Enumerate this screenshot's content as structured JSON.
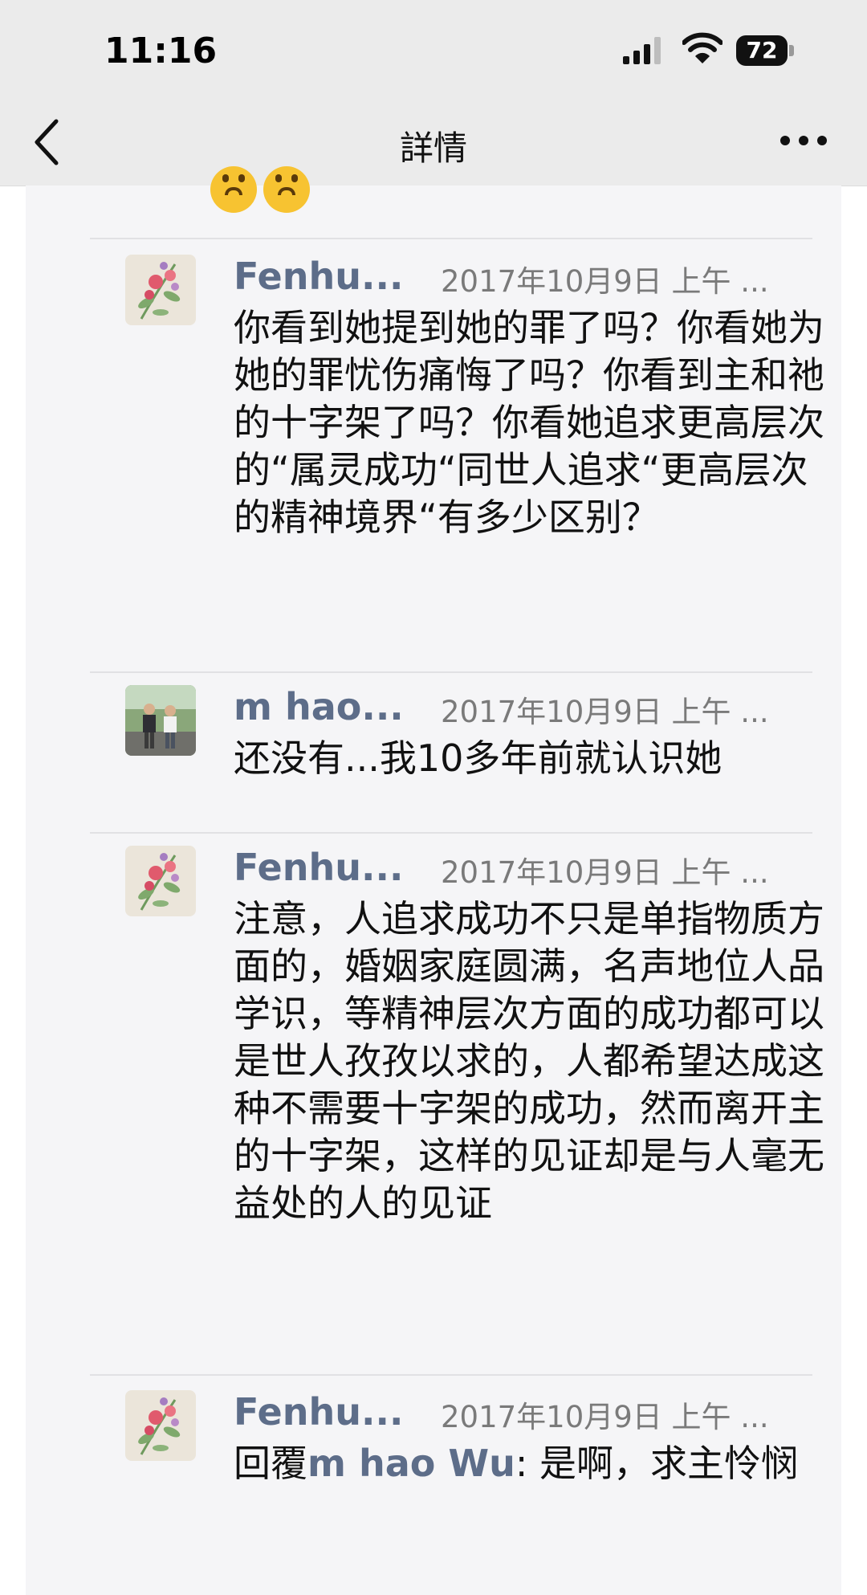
{
  "status_bar": {
    "time": "11:16",
    "battery": "72"
  },
  "nav": {
    "title": "詳情"
  },
  "comments": [
    {
      "author": "Fenhu...",
      "date": "2017年10月9日 上午 ...",
      "text": "你看到她提到她的罪了吗？你看她为她的罪忧伤痛悔了吗？你看到主和祂的十字架了吗？你看她追求更高层次的“属灵成功“同世人追求“更高层次的精神境界“有多少区别？"
    },
    {
      "author": "m hao...",
      "date": "2017年10月9日 上午 ...",
      "text": "还没有...我10多年前就认识她"
    },
    {
      "author": "Fenhu...",
      "date": "2017年10月9日 上午 ...",
      "text": "注意，人追求成功不只是单指物质方面的，婚姻家庭圆满，名声地位人品学识，等精神层次方面的成功都可以是世人孜孜以求的，人都希望达成这种不需要十字架的成功，然而离开主的十字架，这样的见证却是与人毫无益处的人的见证"
    },
    {
      "author": "Fenhu...",
      "date": "2017年10月9日 上午 ...",
      "reply_prefix": "回覆",
      "reply_mention": "m hao Wu",
      "text": ": 是啊，求主怜悯"
    }
  ]
}
